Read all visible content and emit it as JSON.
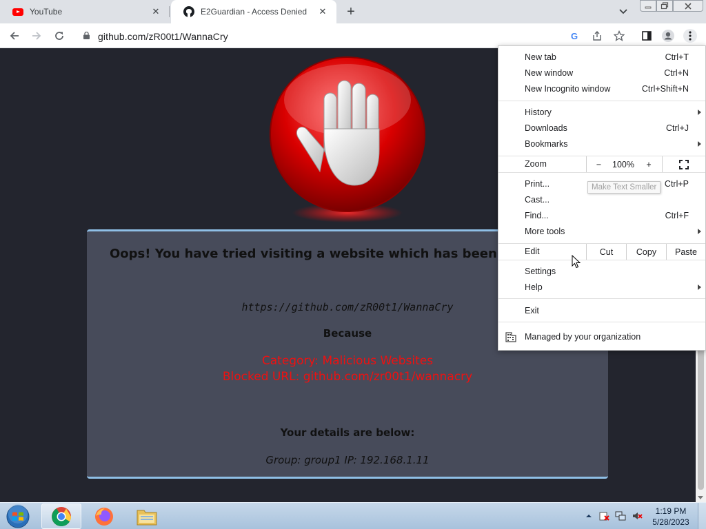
{
  "browser": {
    "tabs": [
      {
        "title": "YouTube",
        "icon": "youtube-icon",
        "active": false
      },
      {
        "title": "E2Guardian - Access Denied",
        "icon": "github-icon",
        "active": true
      }
    ],
    "url": "github.com/zR00t1/WannaCry"
  },
  "page": {
    "message": "Oops! You have tried visiting a website which has been deemed",
    "blocked_url": "https://github.com/zR00t1/WannaCry",
    "because": "Because",
    "category": "Category: Malicious Websites",
    "blocked_reason": "Blocked URL: github.com/zr00t1/wannacry",
    "details_heading": "Your details are below:",
    "details": "Group: group1   IP: 192.168.1.11",
    "accent_color": "#ee1111"
  },
  "menu": {
    "items": [
      {
        "label": "New tab",
        "shortcut": "Ctrl+T"
      },
      {
        "label": "New window",
        "shortcut": "Ctrl+N"
      },
      {
        "label": "New Incognito window",
        "shortcut": "Ctrl+Shift+N"
      },
      {
        "label": "History",
        "shortcut": ""
      },
      {
        "label": "Downloads",
        "shortcut": "Ctrl+J"
      },
      {
        "label": "Bookmarks",
        "shortcut": ""
      },
      {
        "label": "Print...",
        "shortcut": "Ctrl+P"
      },
      {
        "label": "Cast...",
        "shortcut": ""
      },
      {
        "label": "Find...",
        "shortcut": "Ctrl+F"
      },
      {
        "label": "More tools",
        "shortcut": ""
      },
      {
        "label": "Settings",
        "shortcut": ""
      },
      {
        "label": "Help",
        "shortcut": ""
      },
      {
        "label": "Exit",
        "shortcut": ""
      }
    ],
    "zoom": {
      "label": "Zoom",
      "minus": "−",
      "value": "100%",
      "plus": "+"
    },
    "edit": {
      "label": "Edit",
      "cut": "Cut",
      "copy": "Copy",
      "paste": "Paste"
    },
    "managed": "Managed by your organization",
    "tooltip": "Make Text Smaller"
  },
  "taskbar": {
    "time": "1:19 PM",
    "date": "5/28/2023",
    "apps": [
      "chrome-icon",
      "firefox-icon",
      "explorer-icon"
    ]
  }
}
